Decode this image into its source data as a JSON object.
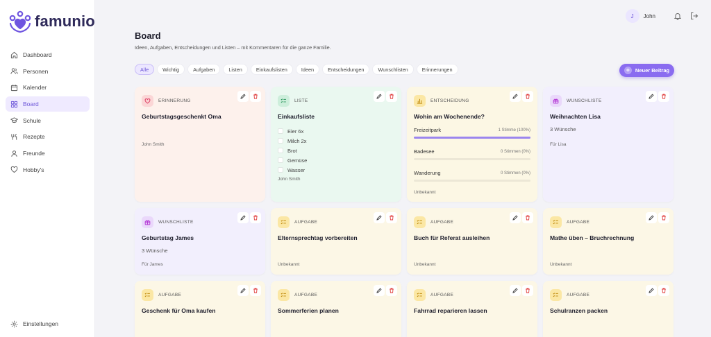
{
  "app": {
    "name": "famunio"
  },
  "sidebar": {
    "items": [
      {
        "label": "Dashboard",
        "icon": "home-icon"
      },
      {
        "label": "Personen",
        "icon": "users-icon"
      },
      {
        "label": "Kalender",
        "icon": "calendar-icon"
      },
      {
        "label": "Board",
        "icon": "grid-icon",
        "active": true
      },
      {
        "label": "Schule",
        "icon": "graduation-cap-icon"
      },
      {
        "label": "Rezepte",
        "icon": "utensils-icon"
      },
      {
        "label": "Freunde",
        "icon": "user-icon"
      },
      {
        "label": "Hobby's",
        "icon": "heart-icon"
      }
    ],
    "settings": {
      "label": "Einstellungen",
      "icon": "gear-icon"
    }
  },
  "topbar": {
    "avatar_initial": "J",
    "username": "John"
  },
  "header": {
    "title": "Board",
    "subtitle": "Ideen, Aufgaben, Entscheidungen und Listen – mit Kommentaren für die ganze Familie."
  },
  "filters": [
    "Alle",
    "Wichtig",
    "Aufgaben",
    "Listen",
    "Einkaufslisten",
    "Ideen",
    "Entscheidungen",
    "Wunschlisten",
    "Erinnerungen"
  ],
  "active_filter": "Alle",
  "new_button": {
    "label": "Neuer Beitrag"
  },
  "colors": {
    "accent": "#8a6cf0",
    "reminder": "#fdf1ec",
    "list": "#eaf8f0",
    "decision": "#fcf7e4",
    "wish": "#f2effd",
    "task": "#fcf7e6"
  },
  "cards": {
    "c1": {
      "type": "ERINNERUNG",
      "title": "Geburtstagsgeschenkt Oma",
      "footer": "John Smith"
    },
    "c2": {
      "type": "LISTE",
      "title": "Einkaufsliste",
      "items": [
        "Eier 6x",
        "Milch 2x",
        "Brot",
        "Gemüse",
        "Wasser"
      ],
      "footer": "John Smith"
    },
    "c3": {
      "type": "ENTSCHEIDUNG",
      "title": "Wohin am Wochenende?",
      "options": [
        {
          "label": "Freizeitpark",
          "votes": "1 Stimme (100%)",
          "percent": 100
        },
        {
          "label": "Badesee",
          "votes": "0 Stimmen (0%)",
          "percent": 0
        },
        {
          "label": "Wanderung",
          "votes": "0 Stimmen (0%)",
          "percent": 0
        }
      ],
      "footer": "Unbekannt"
    },
    "c4": {
      "type": "WUNSCHLISTE",
      "title": "Weihnachten Lisa",
      "subtitle": "3 Wünsche",
      "footer": "Für Lisa"
    },
    "c5": {
      "type": "WUNSCHLISTE",
      "title": "Geburtstag James",
      "subtitle": "3 Wünsche",
      "footer": "Für James"
    },
    "c6": {
      "type": "AUFGABE",
      "title": "Elternsprechtag vorbereiten",
      "footer": "Unbekannt"
    },
    "c7": {
      "type": "AUFGABE",
      "title": "Buch für Referat ausleihen",
      "footer": "Unbekannt"
    },
    "c8": {
      "type": "AUFGABE",
      "title": "Mathe üben – Bruchrechnung",
      "footer": "Unbekannt"
    },
    "c9": {
      "type": "AUFGABE",
      "title": "Geschenk für Oma kaufen"
    },
    "c10": {
      "type": "AUFGABE",
      "title": "Sommerferien planen"
    },
    "c11": {
      "type": "AUFGABE",
      "title": "Fahrrad reparieren lassen"
    },
    "c12": {
      "type": "AUFGABE",
      "title": "Schulranzen packen"
    }
  }
}
